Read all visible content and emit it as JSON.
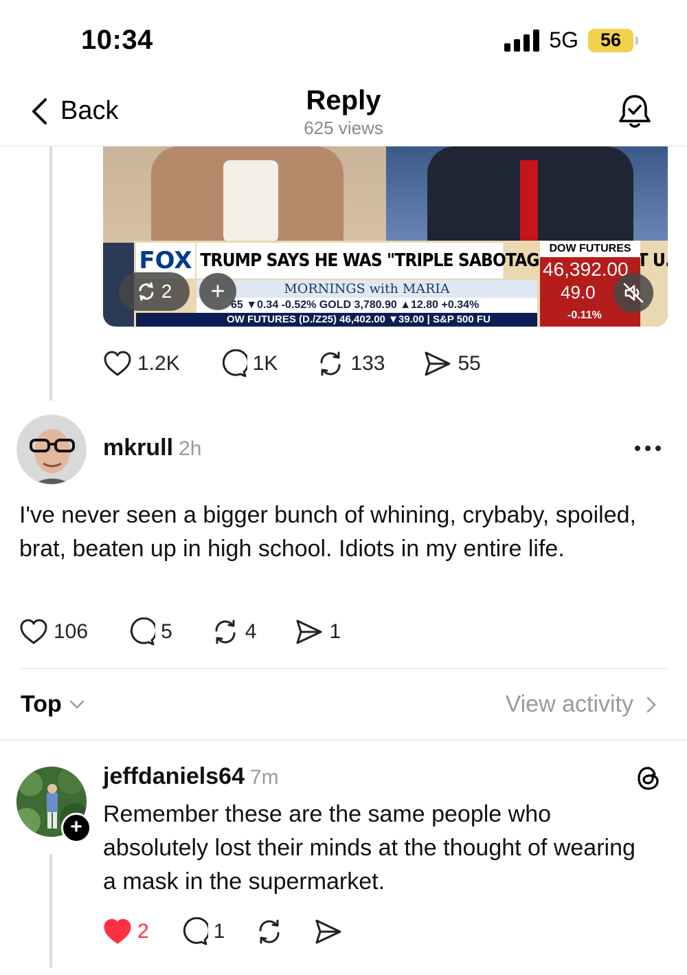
{
  "status_bar": {
    "time": "10:34",
    "network": "5G",
    "battery": "56"
  },
  "header": {
    "back_label": "Back",
    "title": "Reply",
    "views": "625 views"
  },
  "video": {
    "network_logo": "FOX",
    "headline": "TRUMP SAYS HE WAS \"TRIPLE SABOTAGE\" VICTIM AT U.N.",
    "show_name": "MORNINGS with MARIA",
    "ticker_line1": "65 ▼0.34 -0.52% GOLD 3,780.90 ▲12.80 +0.34%",
    "ticker_line2": "OW FUTURES (D./Z25) 46,402.00 ▼39.00 | S&P 500 FU",
    "dow_label": "DOW FUTURES",
    "dow_value": "46,392.00",
    "dow_change": "49.0",
    "dow_pct": "-0.11%",
    "repost_count": "2"
  },
  "parent_actions": {
    "likes": "1.2K",
    "replies": "1K",
    "reposts": "133",
    "shares": "55"
  },
  "post": {
    "username": "mkrull",
    "time": "2h",
    "text": "I've never seen a bigger bunch of whining, crybaby, spoiled, brat, beaten up in high school. Idiots in my entire life.",
    "likes": "106",
    "replies": "5",
    "reposts": "4",
    "shares": "1"
  },
  "sort": {
    "label": "Top",
    "activity_label": "View activity"
  },
  "reply": {
    "username": "jeffdaniels64",
    "time": "7m",
    "text": "Remember these are the same people who absolutely lost their minds at the thought of wearing a mask in the supermarket.",
    "likes": "2",
    "replies": "1"
  },
  "colors": {
    "like_active": "#ff3040",
    "muted_text": "#9a9a9a",
    "battery": "#f2d24a"
  },
  "icons": [
    "back-chevron-icon",
    "bell-check-icon",
    "heart-icon",
    "comment-icon",
    "repost-icon",
    "share-icon",
    "more-icon",
    "threads-icon",
    "mute-icon",
    "plus-icon"
  ]
}
